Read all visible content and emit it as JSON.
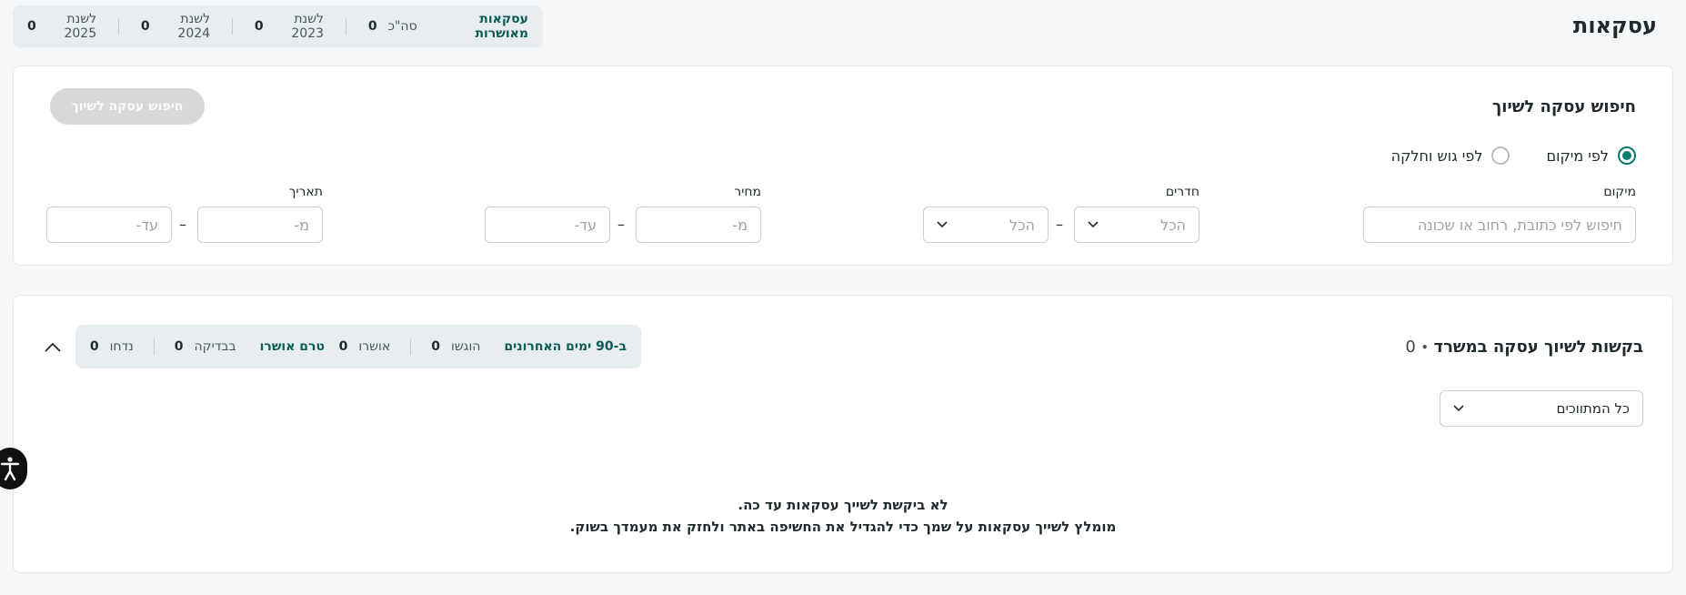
{
  "page": {
    "title": "עסקאות"
  },
  "stats": {
    "title": "עסקאות מאושרות",
    "items": [
      {
        "label": "סה\"כ",
        "value": "0"
      },
      {
        "label": "לשנת 2023",
        "value": "0"
      },
      {
        "label": "לשנת 2024",
        "value": "0"
      },
      {
        "label": "לשנת 2025",
        "value": "0"
      }
    ]
  },
  "search": {
    "title": "חיפוש עסקה לשיוך",
    "button_label": "חיפוש עסקה לשיוך",
    "radios": [
      {
        "label": "לפי מיקום",
        "selected": true
      },
      {
        "label": "לפי גוש וחלקה",
        "selected": false
      }
    ],
    "location": {
      "label": "מיקום",
      "placeholder": "חיפוש לפי כתובת, רחוב או שכונה"
    },
    "rooms": {
      "label": "חדרים",
      "from": "הכל",
      "to": "הכל"
    },
    "price": {
      "label": "מחיר",
      "from_placeholder": "מ-",
      "to_placeholder": "עד-"
    },
    "date": {
      "label": "תאריך",
      "from_placeholder": "מ-",
      "to_placeholder": "עד-"
    },
    "dash": "–"
  },
  "requests": {
    "title": "בקשות לשיוך עסקה במשרד",
    "bullet": "•",
    "count": "0",
    "pill_recent": {
      "title": "ב-90 ימים האחרונים",
      "items": [
        {
          "label": "הוגשו",
          "value": "0"
        },
        {
          "label": "אושרו",
          "value": "0"
        }
      ]
    },
    "pill_pending": {
      "title": "טרם אושרו",
      "items": [
        {
          "label": "בבדיקה",
          "value": "0"
        },
        {
          "label": "נדחו",
          "value": "0"
        }
      ]
    },
    "filter": {
      "value": "כל המתווכים"
    },
    "empty_line1": "לא ביקשת לשייך עסקאות עד כה.",
    "empty_line2": "מומלץ לשייך עסקאות על שמך כדי להגדיל את החשיפה באתר ולחזק את מעמדך בשוק."
  },
  "colors": {
    "accent": "#0b7a6f",
    "accent_dark": "#0b5c55",
    "pill_bg": "#e8eef0"
  },
  "icons": {
    "collapse": "chevron-up-icon",
    "select": "chevron-down-icon",
    "accessibility": "accessibility-icon"
  }
}
